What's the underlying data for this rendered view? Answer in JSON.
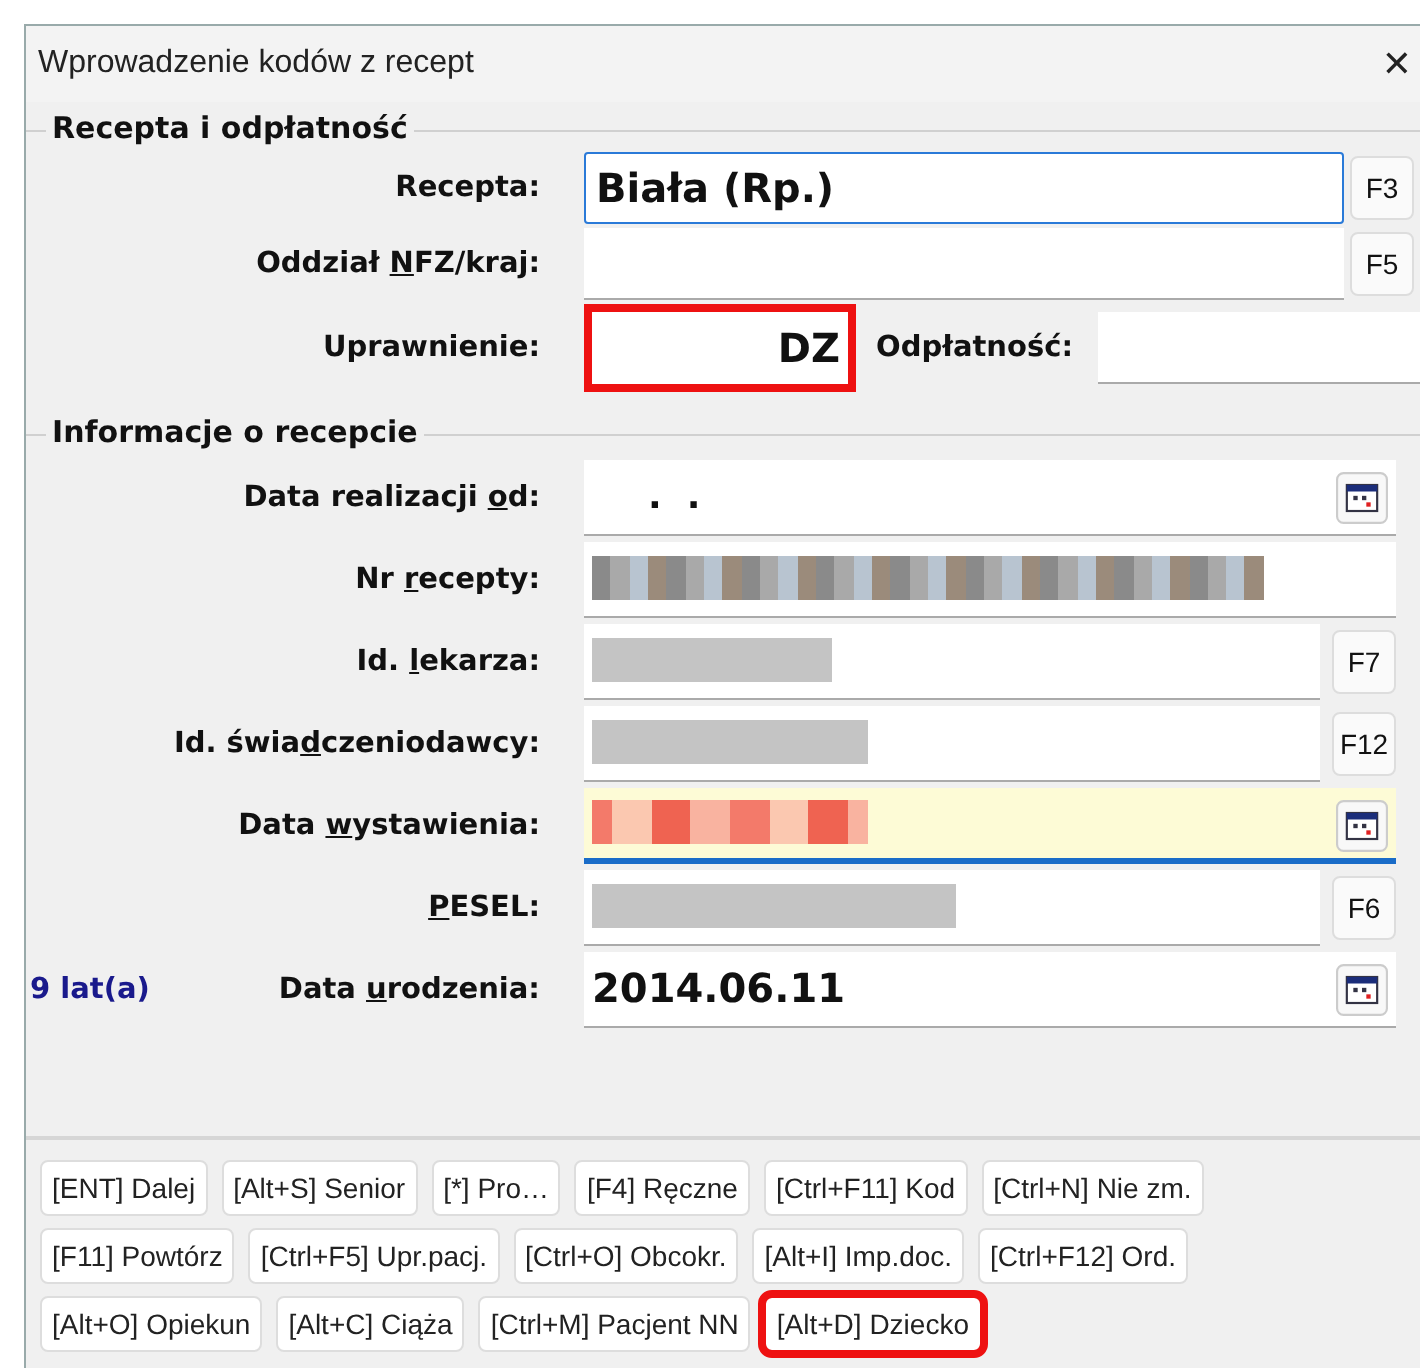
{
  "window": {
    "title": "Wprowadzenie kodów z recept",
    "close": "✕"
  },
  "group_1": {
    "title": "Recepta i odpłatność",
    "rows": [
      {
        "kind": "lookup",
        "label": {
          "before": "Recepta:"
        },
        "value": "Biała (Rp.)",
        "key": "F3",
        "outlined": true
      },
      {
        "kind": "lookup",
        "label": {
          "before": "Oddział ",
          "mnemonic": "N",
          "after": "FZ/kraj:"
        },
        "key": "F5",
        "outlined": false
      }
    ],
    "entitlement": {
      "label": "Uprawnienie:",
      "value": "DZ",
      "highlighted": true
    },
    "payment": {
      "label": "Odpłatność:"
    }
  },
  "group_2": {
    "title": "Informacje o recepcie",
    "rows": [
      {
        "kind": "date",
        "label": {
          "before": "Data realizacji ",
          "mnemonic": "o",
          "after": "d:"
        },
        "value": ".  .",
        "focused": false
      },
      {
        "kind": "text",
        "label": {
          "before": "Nr ",
          "mnemonic": "r",
          "after": "ecepty:"
        },
        "redacted": true,
        "focused": false
      },
      {
        "kind": "lookup",
        "label": {
          "before": "Id. ",
          "mnemonic": "l",
          "after": "ekarza:"
        },
        "redacted": true,
        "key": "F7",
        "focused": false
      },
      {
        "kind": "lookup",
        "label": {
          "before": "Id. świa",
          "mnemonic": "d",
          "after": "czeniodawcy:"
        },
        "redacted": true,
        "key": "F12",
        "focused": false
      },
      {
        "kind": "date",
        "label": {
          "before": "Data ",
          "mnemonic": "w",
          "after": "ystawienia:"
        },
        "redacted": true,
        "focused": true
      },
      {
        "kind": "lookup",
        "label": {
          "mnemonic": "P",
          "after": "ESEL:"
        },
        "redacted": true,
        "key": "F6",
        "focused": false
      },
      {
        "kind": "date",
        "label": {
          "before": "Data ",
          "mnemonic": "u",
          "after": "rodzenia:"
        },
        "value": "2014.06.11",
        "prefix": "9 lat(a)",
        "focused": false
      }
    ]
  },
  "button_rows": [
    [
      {
        "label": "[ENT] Dalej",
        "highlighted": false
      },
      {
        "label": "[Alt+S] Senior",
        "highlighted": false
      },
      {
        "label": "[*] Pro…",
        "highlighted": false
      },
      {
        "label": "[F4] Ręczne",
        "highlighted": false
      },
      {
        "label": "[Ctrl+F11] Kod",
        "highlighted": false
      },
      {
        "label": "[Ctrl+N] Nie zm.",
        "highlighted": false
      }
    ],
    [
      {
        "label": "[F11] Powtórz",
        "highlighted": false
      },
      {
        "label": "[Ctrl+F5] Upr.pacj.",
        "highlighted": false
      },
      {
        "label": "[Ctrl+O] Obcokr.",
        "highlighted": false
      },
      {
        "label": "[Alt+I] Imp.doc.",
        "highlighted": false
      },
      {
        "label": "[Ctrl+F12] Ord.",
        "highlighted": false
      }
    ],
    [
      {
        "label": "[Alt+O] Opiekun",
        "highlighted": false
      },
      {
        "label": "[Alt+C] Ciąża",
        "highlighted": false
      },
      {
        "label": "[Ctrl+M] Pacjent NN",
        "highlighted": false
      },
      {
        "label": "[Alt+D] Dziecko",
        "highlighted": true
      }
    ]
  ]
}
